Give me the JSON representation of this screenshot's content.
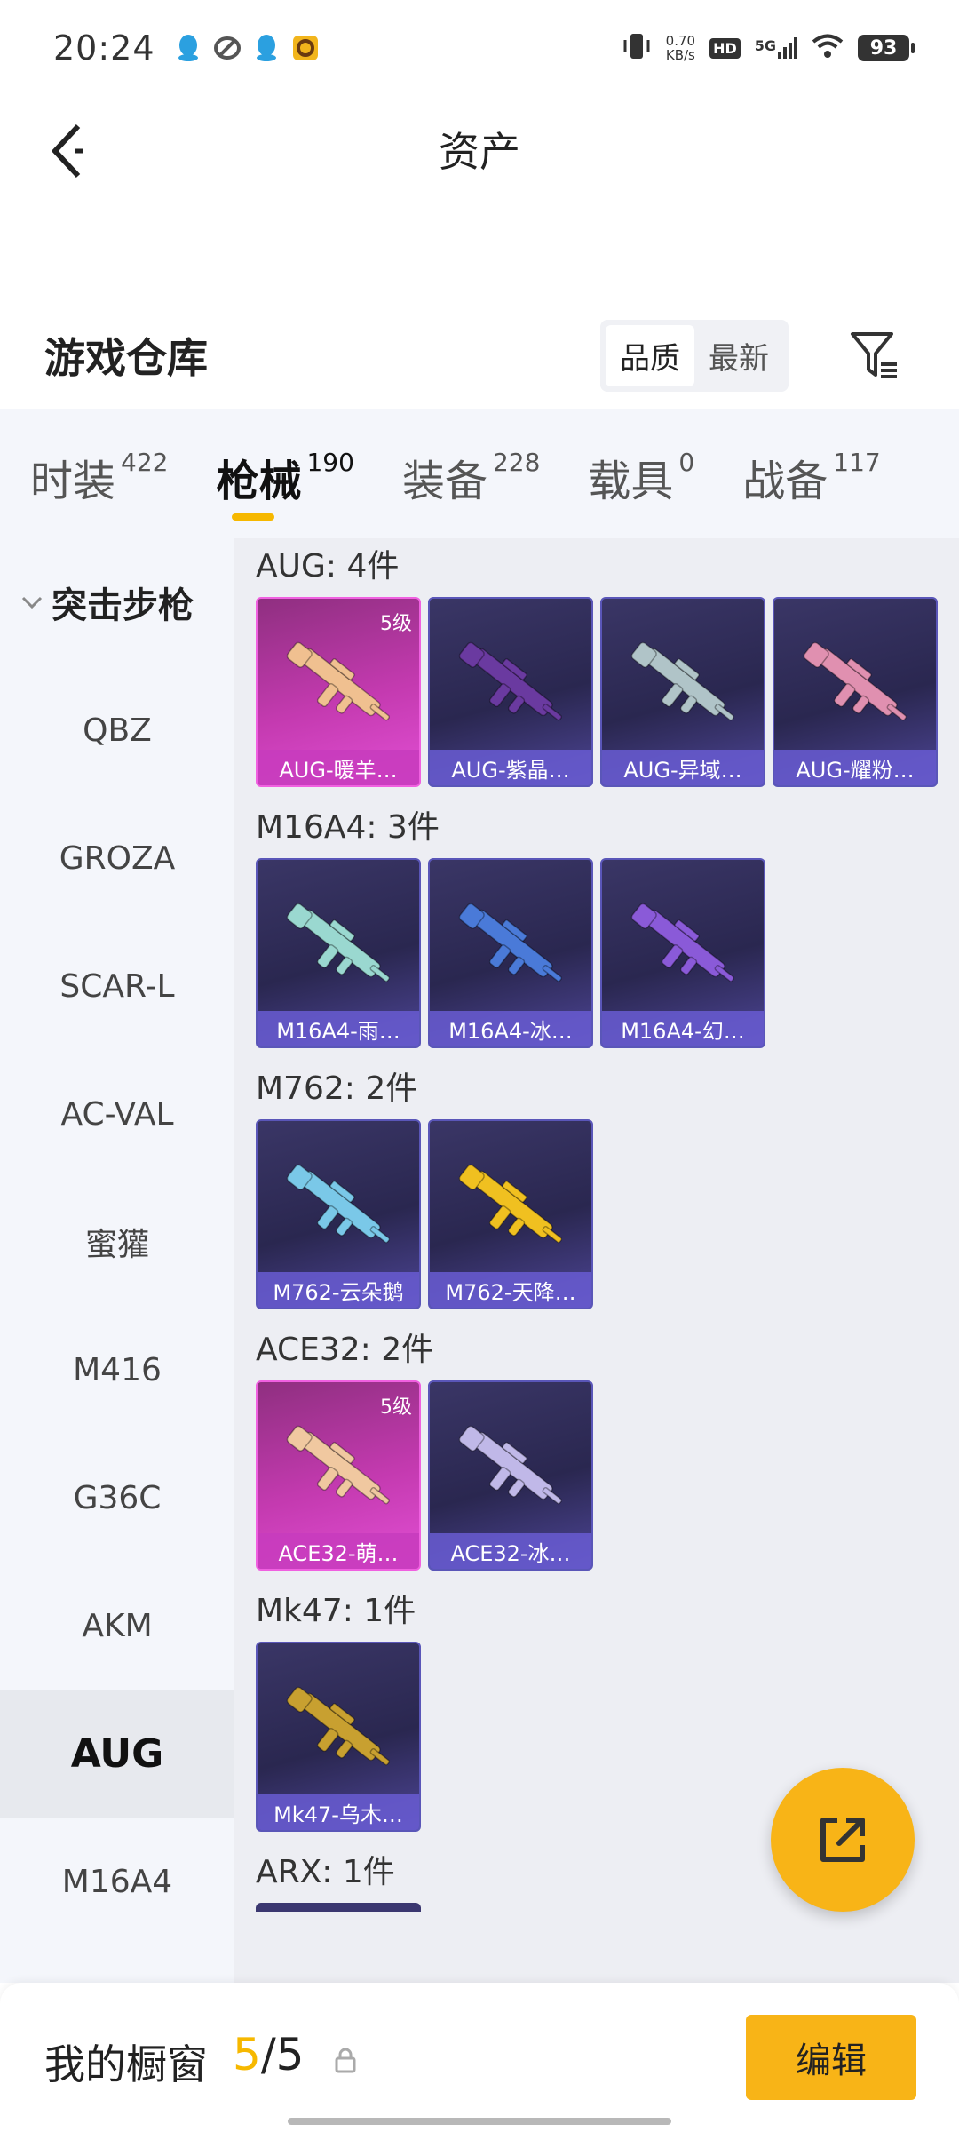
{
  "status_bar": {
    "time": "20:24",
    "net_speed_value": "0.70",
    "net_speed_unit": "KB/s",
    "hd_badge": "HD",
    "network": "5G",
    "battery": "93"
  },
  "nav": {
    "title": "资产"
  },
  "warehouse": {
    "title": "游戏仓库",
    "sort_options": [
      "品质",
      "最新"
    ],
    "sort_selected": "品质"
  },
  "tabs": [
    {
      "label": "时装",
      "count": "422"
    },
    {
      "label": "枪械",
      "count": "190",
      "active": true
    },
    {
      "label": "装备",
      "count": "228"
    },
    {
      "label": "载具",
      "count": "0"
    },
    {
      "label": "战备",
      "count": "117"
    }
  ],
  "categories": {
    "header": "突击步枪",
    "items": [
      "QBZ",
      "GROZA",
      "SCAR-L",
      "AC-VAL",
      "蜜獾",
      "M416",
      "G36C",
      "AKM",
      "AUG",
      "M16A4"
    ],
    "selected": "AUG"
  },
  "groups": [
    {
      "title": "AUG: 4件",
      "items": [
        {
          "name": "AUG-暖羊…",
          "level": "5级",
          "quality": "legendary",
          "color": "#f0c090"
        },
        {
          "name": "AUG-紫晶…",
          "quality": "epic",
          "color": "#6a3aa0"
        },
        {
          "name": "AUG-异域…",
          "quality": "epic",
          "color": "#b0c4c8"
        },
        {
          "name": "AUG-耀粉…",
          "quality": "epic",
          "color": "#e090b0"
        }
      ]
    },
    {
      "title": "M16A4: 3件",
      "items": [
        {
          "name": "M16A4-雨…",
          "quality": "epic",
          "color": "#9ad8d0"
        },
        {
          "name": "M16A4-冰…",
          "quality": "epic",
          "color": "#4a7ad8"
        },
        {
          "name": "M16A4-幻…",
          "quality": "epic",
          "color": "#8a5ad8"
        }
      ]
    },
    {
      "title": "M762: 2件",
      "items": [
        {
          "name": "M762-云朵鹅",
          "quality": "epic",
          "color": "#7ac8e8"
        },
        {
          "name": "M762-天降…",
          "quality": "epic",
          "color": "#f0c020"
        }
      ]
    },
    {
      "title": "ACE32: 2件",
      "items": [
        {
          "name": "ACE32-萌…",
          "level": "5级",
          "quality": "legendary",
          "color": "#f0c8a0"
        },
        {
          "name": "ACE32-冰…",
          "quality": "epic",
          "color": "#c0b8e8"
        }
      ]
    },
    {
      "title": "Mk47: 1件",
      "items": [
        {
          "name": "Mk47-乌木…",
          "quality": "epic",
          "color": "#c8a030"
        }
      ]
    },
    {
      "title": "ARX: 1件",
      "items": []
    }
  ],
  "showcase": {
    "label": "我的橱窗",
    "current": "5",
    "separator": "/",
    "max": "5",
    "edit_label": "编辑"
  },
  "colors": {
    "accent": "#f8b417",
    "legendary": "#e24fd4",
    "epic": "#5a56b8"
  }
}
